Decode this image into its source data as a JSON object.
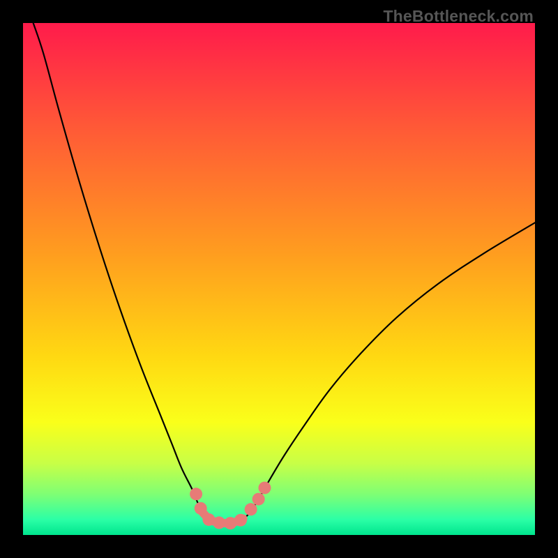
{
  "watermark": "TheBottleneck.com",
  "chart_data": {
    "type": "line",
    "title": "",
    "xlabel": "",
    "ylabel": "",
    "xlim": [
      0,
      100
    ],
    "ylim": [
      0,
      100
    ],
    "grid": false,
    "legend": false,
    "background_gradient_stops": [
      {
        "offset": 0.0,
        "color": "#ff1b4b"
      },
      {
        "offset": 0.2,
        "color": "#ff5837"
      },
      {
        "offset": 0.45,
        "color": "#ff9d1f"
      },
      {
        "offset": 0.65,
        "color": "#ffd812"
      },
      {
        "offset": 0.78,
        "color": "#faff1a"
      },
      {
        "offset": 0.86,
        "color": "#c8ff46"
      },
      {
        "offset": 0.92,
        "color": "#7fff74"
      },
      {
        "offset": 0.97,
        "color": "#2bffa6"
      },
      {
        "offset": 1.0,
        "color": "#00e58e"
      }
    ],
    "series": [
      {
        "name": "bottleneck-curve",
        "type": "line",
        "color": "#000000",
        "points": [
          {
            "x": 2.0,
            "y": 100.0
          },
          {
            "x": 4.0,
            "y": 94.0
          },
          {
            "x": 7.0,
            "y": 83.0
          },
          {
            "x": 11.0,
            "y": 69.0
          },
          {
            "x": 15.0,
            "y": 56.0
          },
          {
            "x": 19.0,
            "y": 44.0
          },
          {
            "x": 23.0,
            "y": 33.0
          },
          {
            "x": 27.0,
            "y": 23.0
          },
          {
            "x": 29.0,
            "y": 18.0
          },
          {
            "x": 31.0,
            "y": 13.0
          },
          {
            "x": 33.0,
            "y": 9.0
          },
          {
            "x": 34.5,
            "y": 5.5
          },
          {
            "x": 36.0,
            "y": 3.5
          },
          {
            "x": 37.5,
            "y": 2.5
          },
          {
            "x": 39.0,
            "y": 2.3
          },
          {
            "x": 40.5,
            "y": 2.3
          },
          {
            "x": 42.0,
            "y": 2.7
          },
          {
            "x": 44.0,
            "y": 4.0
          },
          {
            "x": 46.0,
            "y": 7.0
          },
          {
            "x": 48.0,
            "y": 10.5
          },
          {
            "x": 51.0,
            "y": 15.5
          },
          {
            "x": 55.0,
            "y": 21.5
          },
          {
            "x": 60.0,
            "y": 28.5
          },
          {
            "x": 66.0,
            "y": 35.5
          },
          {
            "x": 73.0,
            "y": 42.5
          },
          {
            "x": 81.0,
            "y": 49.0
          },
          {
            "x": 90.0,
            "y": 55.0
          },
          {
            "x": 100.0,
            "y": 61.0
          }
        ]
      },
      {
        "name": "marker-fill",
        "type": "line",
        "color": "#e77b77",
        "stroke_width": 12,
        "points": [
          {
            "x": 35.0,
            "y": 4.5
          },
          {
            "x": 36.5,
            "y": 3.0
          },
          {
            "x": 38.0,
            "y": 2.5
          },
          {
            "x": 40.0,
            "y": 2.3
          },
          {
            "x": 42.0,
            "y": 2.7
          },
          {
            "x": 43.0,
            "y": 3.2
          }
        ]
      },
      {
        "name": "markers",
        "type": "scatter",
        "color": "#e77b77",
        "radius": 9,
        "points": [
          {
            "x": 33.8,
            "y": 8.0
          },
          {
            "x": 34.7,
            "y": 5.2
          },
          {
            "x": 36.3,
            "y": 3.0
          },
          {
            "x": 38.3,
            "y": 2.4
          },
          {
            "x": 40.5,
            "y": 2.3
          },
          {
            "x": 42.5,
            "y": 2.9
          },
          {
            "x": 44.5,
            "y": 5.0
          },
          {
            "x": 46.0,
            "y": 7.0
          },
          {
            "x": 47.2,
            "y": 9.2
          }
        ]
      }
    ]
  }
}
